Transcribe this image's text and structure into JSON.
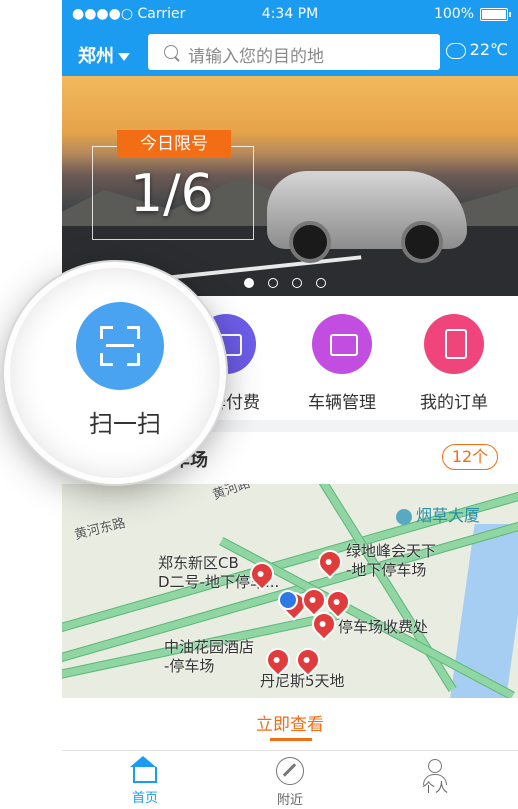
{
  "status": {
    "carrier": "●●●●○ Carrier",
    "time": "4:34 PM",
    "battery": "100%"
  },
  "header": {
    "city": "郑州",
    "search_placeholder": "请输入您的目的地",
    "weather": "22℃"
  },
  "banner": {
    "tag": "今日限号",
    "limit": "1/6",
    "dots": 4,
    "active_dot": 1
  },
  "actions": [
    {
      "label": "扫一扫",
      "icon": "scan-icon"
    },
    {
      "label": "车牌付费",
      "icon": "card-icon",
      "color": "#6c5ce7"
    },
    {
      "label": "车辆管理",
      "icon": "car-icon",
      "color": "#c14ee0"
    },
    {
      "label": "我的订单",
      "icon": "order-icon",
      "color": "#f0457a"
    }
  ],
  "recommend": {
    "title": "推荐附近停车场",
    "count": "12个"
  },
  "map": {
    "landmark": "烟草大厦",
    "roads": [
      "黄河东路",
      "黄河路"
    ],
    "places": [
      "郑东新区CB\nD二号-地下停车...",
      "绿地峰会天下\n-地下停车场",
      "停车场收费处",
      "中油花园酒店\n-停车场",
      "丹尼斯5天地"
    ]
  },
  "view_link": "立即查看",
  "tabs": [
    {
      "label": "首页",
      "icon": "home-icon",
      "active": true
    },
    {
      "label": "附近",
      "icon": "compass-icon",
      "active": false
    },
    {
      "label": "个人",
      "icon": "user-icon",
      "active": false
    }
  ],
  "colors": {
    "brand": "#1b9cf0",
    "accent": "#f36d15"
  }
}
